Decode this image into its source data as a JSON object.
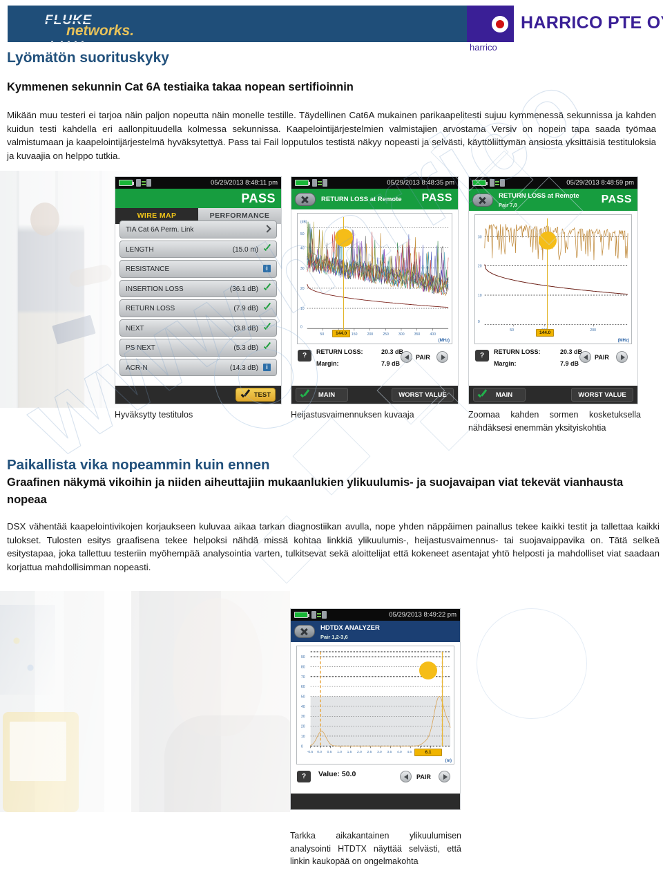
{
  "header": {
    "fluke_brand": "FLUKE",
    "fluke_sub": "networks.",
    "harrico_sub": "harrico",
    "harrico_name": "HARRICO PTE OY"
  },
  "page_title": "Lyömätön suorituskyky",
  "sub_heading": "Kymmenen sekunnin Cat 6A testiaika takaa nopean sertifioinnin",
  "intro_text": "Mikään muu testeri ei tarjoa näin paljon nopeutta näin monelle testille. Täydellinen Cat6A mukainen parikaapelitesti sujuu kymmenessä sekunnissa ja kahden kuidun testi kahdella eri aallonpituudella kolmessa sekunnissa. Kaapelointijärjestelmien valmistajien arvostama Versiv on nopein tapa saada työmaa valmistumaan ja kaapelointijärjestelmä hyväksytettyä. Pass tai Fail lopputulos testistä näkyy nopeasti ja selvästi, käyttöliittymän ansiosta yksittäisiä testituloksia ja kuvaajia on helppo tutkia.",
  "section_title_2": "Paikallista vika nopeammin kuin ennen",
  "section_sub_2": "Graafinen näkymä vikoihin ja niiden aiheuttajiin mukaanlukien ylikuulumis- ja suojavaipan viat tekevät vianhausta nopeaa",
  "body_text_2": "DSX vähentää kaapelointivikojen korjaukseen kuluvaa aikaa tarkan diagnostiikan avulla, nope yhden näppäimen painallus tekee kaikki testit ja tallettaa kaikki tulokset.   Tulosten esitys graafisena tekee helpoksi nähdä missä kohtaa linkkiä ylikuulumis-, heijastusvaimennus- tai suojavaippavika on. Tätä selkeä esitystapaa, joka tallettuu testeriin myöhempää analysointia varten, tulkitsevat sekä aloittelijat että kokeneet asentajat yhtö helposti ja mahdolliset viat saadaan korjattua mahdollisimman nopeasti.",
  "watermark_text": "www.harrico",
  "tester1": {
    "timestamp": "05/29/2013 8:48:11 pm",
    "verdict": "PASS",
    "tab_active": "WIRE MAP",
    "tab_inactive": "PERFORMANCE",
    "rows": [
      {
        "label": "TIA Cat 6A Perm. Link",
        "value": "",
        "mark": "arrow"
      },
      {
        "label": "LENGTH",
        "value": "(15.0 m)",
        "mark": "tick"
      },
      {
        "label": "RESISTANCE",
        "value": "",
        "mark": "info"
      },
      {
        "label": "INSERTION LOSS",
        "value": "(36.1 dB)",
        "mark": "tick"
      },
      {
        "label": "RETURN LOSS",
        "value": "(7.9 dB)",
        "mark": "tick"
      },
      {
        "label": "NEXT",
        "value": "(3.8 dB)",
        "mark": "tick"
      },
      {
        "label": "PS NEXT",
        "value": "(5.3 dB)",
        "mark": "tick"
      },
      {
        "label": "ACR-N",
        "value": "(14.3 dB)",
        "mark": "info"
      }
    ],
    "test_button": "TEST",
    "info_glyph": "i"
  },
  "tester2": {
    "timestamp": "05/29/2013 8:48:35 pm",
    "verdict": "PASS",
    "band_title": "RETURN LOSS at Remote",
    "y_unit": "(dB)",
    "y_ticks": [
      "(dB)",
      "50",
      "40",
      "30",
      "20",
      "10",
      "0"
    ],
    "x_ticks": [
      "50",
      "100",
      "150",
      "200",
      "250",
      "300",
      "350",
      "400"
    ],
    "x_unit": "(MHz)",
    "cursor_value": "144.0",
    "readout_label": "RETURN LOSS:",
    "readout_value": "20.3 dB",
    "margin_label": "Margin:",
    "margin_value": "7.9 dB",
    "pair_label": "PAIR",
    "help_glyph": "?",
    "main_button": "MAIN",
    "worst_button": "WORST VALUE"
  },
  "tester3": {
    "timestamp": "05/29/2013 8:48:59 pm",
    "verdict": "PASS",
    "band_title": "RETURN LOSS at Remote",
    "band_sub": "Pair 7,8",
    "y_ticks": [
      "30",
      "20",
      "10",
      "0"
    ],
    "x_ticks": [
      "50",
      "100",
      "200"
    ],
    "x_unit": "(MHz)",
    "cursor_value": "144.0",
    "readout_label": "RETURN LOSS:",
    "readout_value": "20.3 dB",
    "margin_label": "Margin:",
    "margin_value": "7.9 dB",
    "pair_label": "PAIR",
    "help_glyph": "?",
    "main_button": "MAIN",
    "worst_button": "WORST VALUE"
  },
  "tester4": {
    "timestamp": "05/29/2013 8:49:22 pm",
    "band_title": "HDTDX ANALYZER",
    "band_sub": "Pair 1,2-3,6",
    "y_ticks": [
      "90",
      "80",
      "70",
      "60",
      "50",
      "40",
      "30",
      "20",
      "10",
      "0"
    ],
    "x_ticks": [
      "-0.5",
      "0.0",
      "0.5",
      "1.0",
      "1.5",
      "2.0",
      "2.5",
      "3.0",
      "3.5",
      "4.0",
      "4.5",
      "5.0",
      "5.5"
    ],
    "x_unit": "(m)",
    "cursor_value": "6.1",
    "value_label": "Value: 50.0",
    "pair_label": "PAIR",
    "help_glyph": "?"
  },
  "captions": {
    "cap1": "Hyväksytty testitulos",
    "cap2": "Heijastusvaimennuksen kuvaaja",
    "cap3": "Zoomaa kahden sormen kosketuksella nähdäksesi enemmän yksityiskohtia",
    "cap4": "Tarkka aikakantainen ylikuulumisen analysointi HTDTX näyttää selvästi, että linkin kaukopää on ongelmakohta"
  },
  "chart_data": [
    {
      "type": "line",
      "title": "RETURN LOSS at Remote",
      "xlabel": "(MHz)",
      "ylabel": "(dB)",
      "xlim": [
        1,
        500
      ],
      "ylim": [
        0,
        55
      ],
      "cursor_x": 144.0,
      "series": [
        {
          "name": "Limit",
          "note": "decaying limit curve from ~22 dB at low freq to ~10 dB at high freq"
        },
        {
          "name": "Measured pairs",
          "note": "dense multi-colour noise traces between 15 and 50 dB"
        }
      ]
    },
    {
      "type": "line",
      "title": "RETURN LOSS at Remote - Pair 7,8",
      "xlabel": "(MHz)",
      "ylabel": "(dB)",
      "xlim": [
        1,
        250
      ],
      "ylim": [
        0,
        35
      ],
      "cursor_x": 144.0,
      "series": [
        {
          "name": "Limit",
          "note": "decaying limit curve from ~20 dB to ~10 dB"
        },
        {
          "name": "Pair 7,8",
          "note": "noisy trace oscillating between 24 and 34 dB"
        }
      ]
    },
    {
      "type": "line",
      "title": "HDTDX ANALYZER - Pair 1,2-3,6",
      "xlabel": "(m)",
      "ylabel": "",
      "xlim": [
        -0.5,
        6.5
      ],
      "ylim": [
        0,
        95
      ],
      "cursor_x": 6.1,
      "cursor_value": 50.0,
      "series": [
        {
          "name": "HDTDX",
          "note": "small peak ~15 at 0.0 m, large peak ~50 near 6.1 m (far end)"
        }
      ]
    }
  ]
}
